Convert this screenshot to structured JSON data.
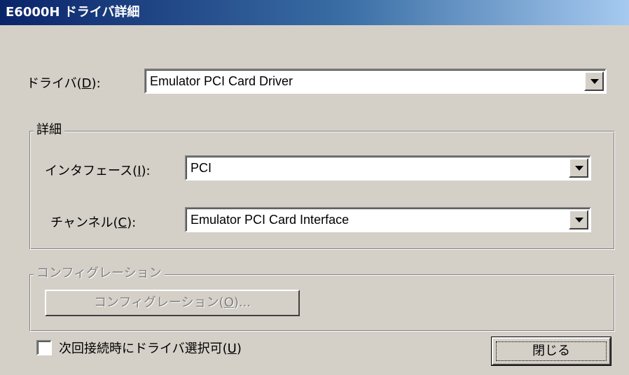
{
  "window": {
    "title": "E6000H ドライバ詳細"
  },
  "driver": {
    "label_pre": "ドライバ(",
    "label_key": "D",
    "label_post": "):",
    "value": "Emulator PCI Card Driver"
  },
  "details": {
    "title": "詳細",
    "interface": {
      "label_pre": "インタフェース(",
      "label_key": "I",
      "label_post": "):",
      "value": "PCI"
    },
    "channel": {
      "label_pre": "チャンネル(",
      "label_key": "C",
      "label_post": "):",
      "value": "Emulator PCI Card Interface"
    }
  },
  "configuration": {
    "title": "コンフィグレーション",
    "button_pre": "コンフィグレーション(",
    "button_key": "O",
    "button_post": ")..."
  },
  "footer": {
    "checkbox_pre": "次回接続時にドライバ選択可(",
    "checkbox_key": "U",
    "checkbox_post": ")",
    "checkbox_checked": false,
    "close_label": "閉じる"
  },
  "colors": {
    "face": "#d4d0c8",
    "title_start": "#0a246a",
    "title_end": "#a6caf0",
    "disabled_text": "#808080"
  }
}
